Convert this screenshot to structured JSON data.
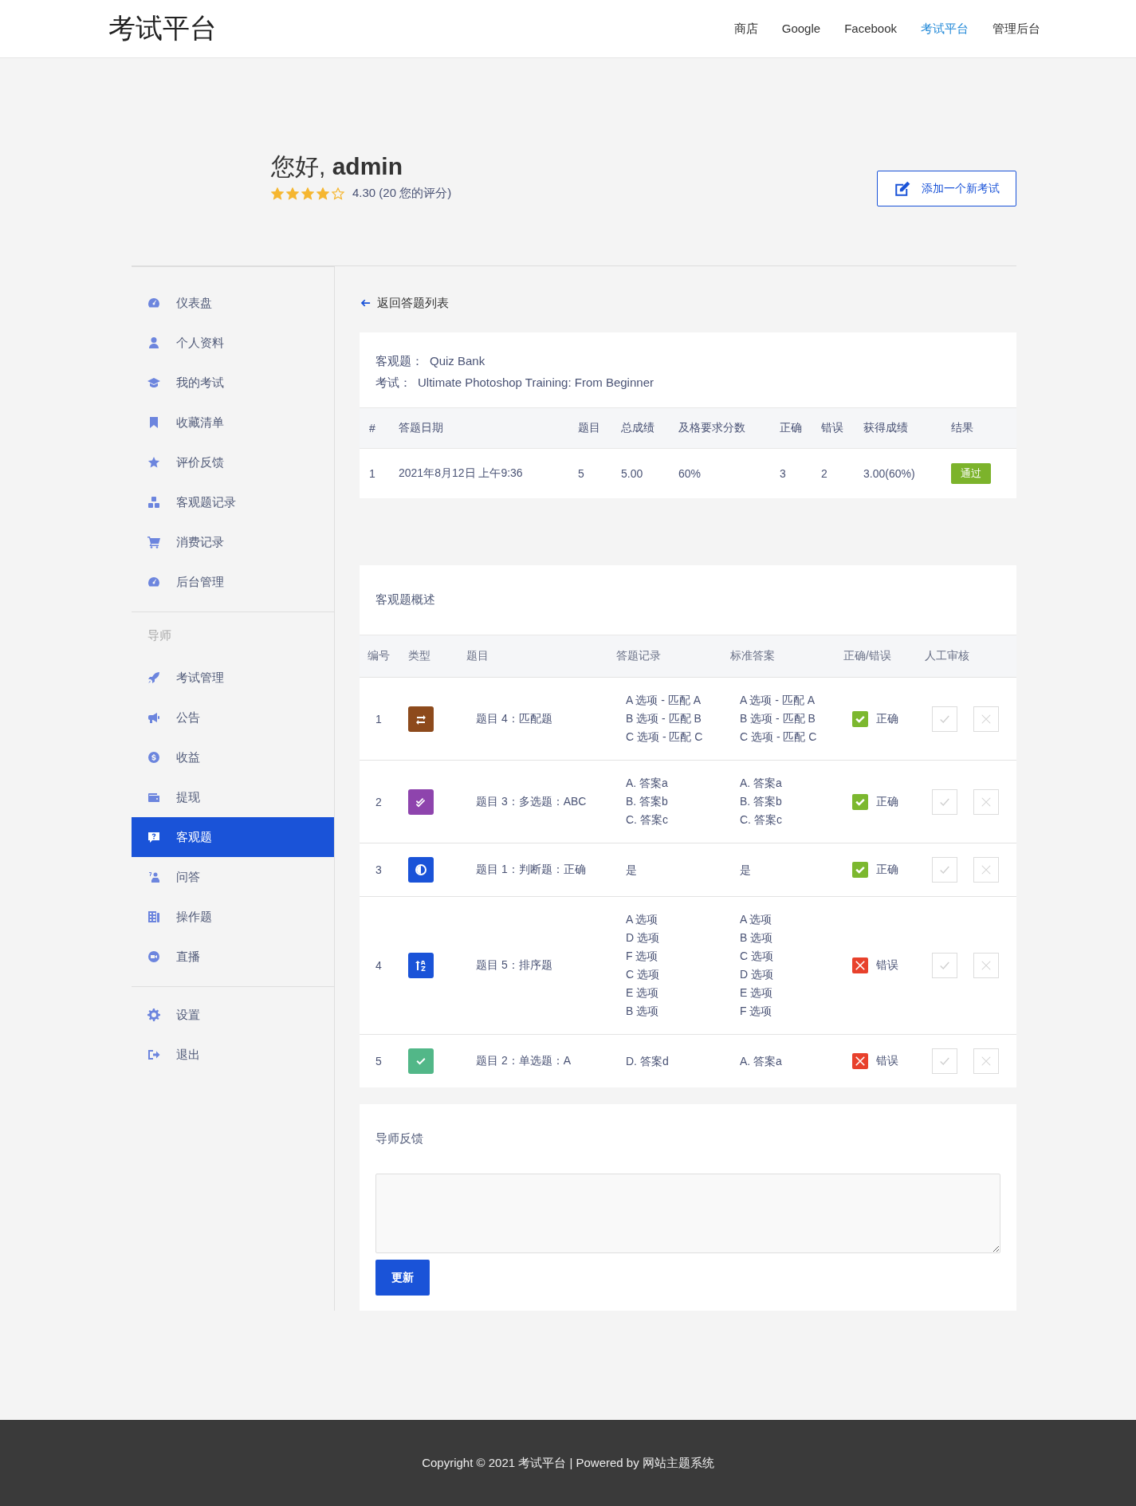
{
  "header": {
    "logo": "考试平台",
    "nav": [
      {
        "label": "商店",
        "selected": false
      },
      {
        "label": "Google",
        "selected": false
      },
      {
        "label": "Facebook",
        "selected": false
      },
      {
        "label": "考试平台",
        "selected": true
      },
      {
        "label": "管理后台",
        "selected": false
      }
    ]
  },
  "profile": {
    "greeting": "您好, **admin**",
    "stars": 4,
    "rating": "4.30 (20 您的评分)",
    "add_button": "添加一个新考试"
  },
  "sidebar": {
    "groups": [
      {
        "items": [
          {
            "label": "仪表盘",
            "selected": false
          },
          {
            "label": "个人资料",
            "selected": false
          },
          {
            "label": "我的考试",
            "selected": false
          },
          {
            "label": "收藏清单",
            "selected": false
          },
          {
            "label": "评价反馈",
            "selected": false
          },
          {
            "label": "客观题记录",
            "selected": false
          },
          {
            "label": "消费记录",
            "selected": false
          },
          {
            "label": "后台管理",
            "selected": false
          }
        ]
      },
      {
        "heading": "导师",
        "items": [
          {
            "label": "考试管理",
            "selected": false
          },
          {
            "label": "公告",
            "selected": false
          },
          {
            "label": "收益",
            "selected": false
          },
          {
            "label": "提现",
            "selected": false
          },
          {
            "label": "客观题",
            "selected": true
          },
          {
            "label": "问答",
            "selected": false
          },
          {
            "label": "操作题",
            "selected": false
          },
          {
            "label": "直播",
            "selected": false
          }
        ]
      },
      {
        "items": [
          {
            "label": "设置",
            "selected": false
          },
          {
            "label": "退出",
            "selected": false
          }
        ]
      }
    ]
  },
  "back_link": "返回答题列表",
  "attempt": {
    "quiz_label": "客观题：",
    "quiz": "Quiz Bank",
    "exam_label": "考试：",
    "exam": "Ultimate Photoshop Training: From Beginner",
    "columns": [
      "#",
      "答题日期",
      "题目",
      "总成绩",
      "及格要求分数",
      "正确",
      "错误",
      "获得成绩",
      "结果"
    ],
    "rows": [
      {
        "cells": [
          "1",
          "2021年8月12日 上午9:36",
          "5",
          "5.00",
          "60%",
          "3",
          "2",
          "3.00(60%)"
        ],
        "result": "通过",
        "passed": true
      }
    ]
  },
  "overview": {
    "title": "客观题概述",
    "columns": [
      "编号",
      "类型",
      "题目",
      "答题记录",
      "标准答案",
      "正确/错误",
      "人工审核"
    ],
    "rows": [
      {
        "number": "1",
        "kind": "matching",
        "question": "题目 4：匹配题",
        "answer": [
          "A 选项 - 匹配 A",
          "B 选项 - 匹配 B",
          "C 选项 - 匹配 C"
        ],
        "correct_answer": [
          "A 选项 - 匹配 A",
          "B 选项 - 匹配 B",
          "C 选项 - 匹配 C"
        ],
        "correct": true,
        "verdict": "正确"
      },
      {
        "number": "2",
        "kind": "multiple",
        "question": "题目 3：多选题：ABC",
        "answer": [
          "A. 答案a",
          "B. 答案b",
          "C. 答案c"
        ],
        "correct_answer": [
          "A. 答案a",
          "B. 答案b",
          "C. 答案c"
        ],
        "correct": true,
        "verdict": "正确"
      },
      {
        "number": "3",
        "kind": "truefalse",
        "question": "题目 1：判断题：正确",
        "answer": [
          "是"
        ],
        "correct_answer": [
          "是"
        ],
        "correct": true,
        "verdict": "正确"
      },
      {
        "number": "4",
        "kind": "ordering",
        "question": "题目 5：排序题",
        "answer": [
          "A 选项",
          "D 选项",
          "F 选项",
          "C 选项",
          "E 选项",
          "B 选项"
        ],
        "correct_answer": [
          "A 选项",
          "B 选项",
          "C 选项",
          "D 选项",
          "E 选项",
          "F 选项"
        ],
        "correct": false,
        "verdict": "错误"
      },
      {
        "number": "5",
        "kind": "single",
        "question": "题目 2：单选题：A",
        "answer": [
          "D. 答案d"
        ],
        "correct_answer": [
          "A. 答案a"
        ],
        "correct": false,
        "verdict": "错误"
      }
    ]
  },
  "feedback": {
    "title": "导师反馈",
    "button": "更新"
  },
  "footer": {
    "text": "Copyright © 2021 考试平台 | Powered by 网站主题系统"
  }
}
